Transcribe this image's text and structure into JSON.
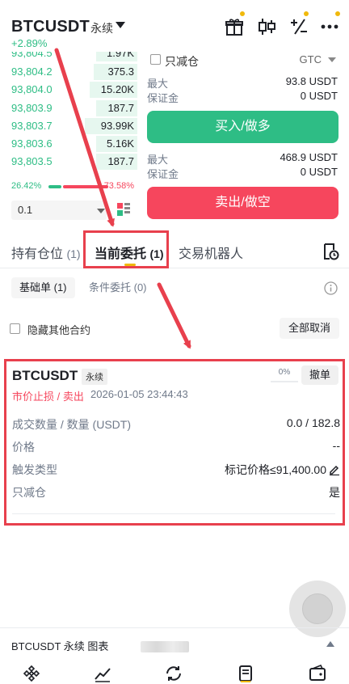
{
  "header": {
    "symbol": "BTCUSDT",
    "contract_type": "永续",
    "change": "+2.89%",
    "icons": [
      "gift-icon",
      "candlestick-icon",
      "calculator-icon",
      "more-icon"
    ]
  },
  "orderbook": {
    "rows": [
      {
        "price": "93,804.5",
        "qty": "1.97K",
        "depth": 0.3
      },
      {
        "price": "93,804.2",
        "qty": "375.3",
        "depth": 0.32
      },
      {
        "price": "93,804.0",
        "qty": "15.20K",
        "depth": 0.35
      },
      {
        "price": "93,803.9",
        "qty": "187.7",
        "depth": 0.3
      },
      {
        "price": "93,803.7",
        "qty": "93.99K",
        "depth": 0.38
      },
      {
        "price": "93,803.6",
        "qty": "5.16K",
        "depth": 0.3
      },
      {
        "price": "93,803.5",
        "qty": "187.7",
        "depth": 0.3
      }
    ],
    "buy_ratio": "26.42%",
    "sell_ratio": "73.58%",
    "precision": "0.1"
  },
  "order_form": {
    "reduce_only_label": "只减仓",
    "time_in_force": "GTC",
    "buy": {
      "max_label": "最大",
      "max_value": "93.8 USDT",
      "margin_label": "保证金",
      "margin_value": "0 USDT",
      "button": "买入/做多"
    },
    "sell": {
      "max_label": "最大",
      "max_value": "468.9 USDT",
      "margin_label": "保证金",
      "margin_value": "0 USDT",
      "button": "卖出/做空"
    }
  },
  "tabs": {
    "positions": {
      "label": "持有仓位",
      "count": "(1)"
    },
    "open_orders": {
      "label": "当前委托",
      "count": "(1)"
    },
    "bots": {
      "label": "交易机器人"
    }
  },
  "subtabs": {
    "basic": "基础单 (1)",
    "conditional": "条件委托 (0)"
  },
  "hide_other_label": "隐藏其他合约",
  "cancel_all_label": "全部取消",
  "order": {
    "symbol": "BTCUSDT",
    "contract_type": "永续",
    "progress": "0%",
    "cancel_label": "撤单",
    "type": "市价止损 / 卖出",
    "time": "2026-01-05 23:44:43",
    "rows": [
      {
        "label": "成交数量 / 数量 (USDT)",
        "value": "0.0 / 182.8"
      },
      {
        "label": "价格",
        "value": "--"
      },
      {
        "label": "触发类型",
        "value": "标记价格≤91,400.00"
      },
      {
        "label": "只减仓",
        "value": "是"
      }
    ]
  },
  "chart_strip": {
    "label": "BTCUSDT 永续  图表"
  },
  "bottom_nav": [
    "home-icon",
    "markets-icon",
    "trade-icon",
    "futures-icon",
    "wallet-icon"
  ],
  "colors": {
    "buy": "#2ebd85",
    "sell": "#f6465d",
    "accent": "#f0b90b",
    "annotation": "#e8404d"
  }
}
